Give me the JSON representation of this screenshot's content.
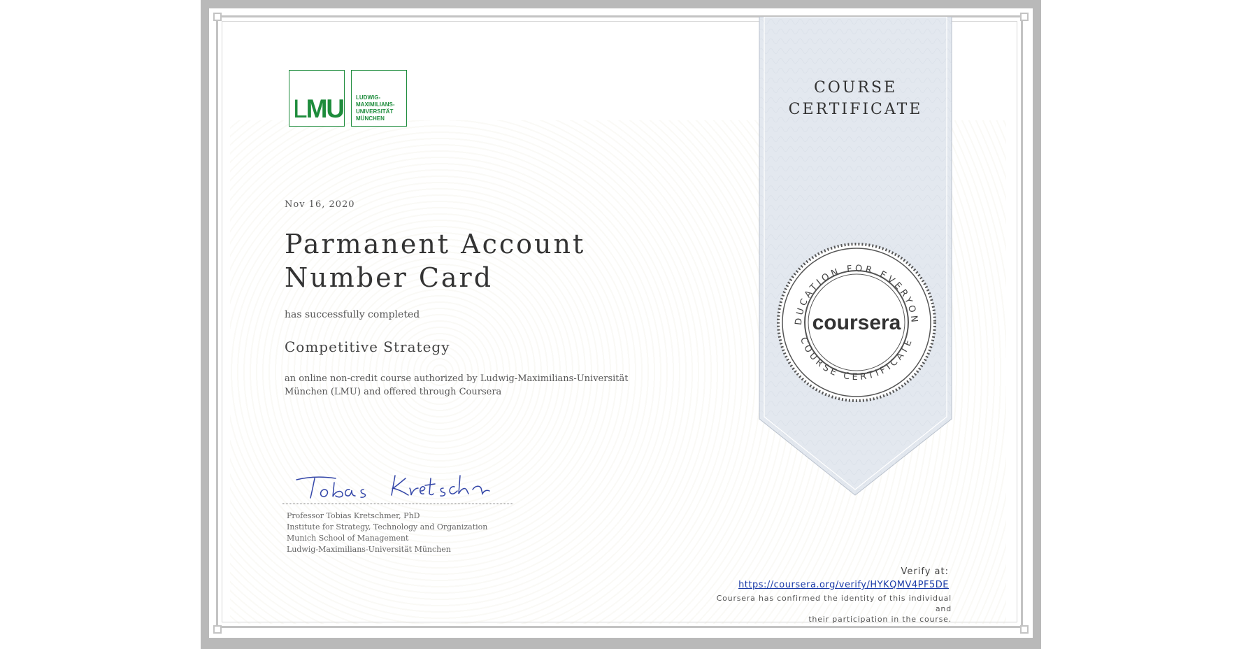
{
  "logo": {
    "abbr_l": "L",
    "abbr_mu": "MU",
    "name_lines": [
      "LUDWIG-",
      "MAXIMILIANS-",
      "UNIVERSITÄT",
      "MÜNCHEN"
    ]
  },
  "certificate": {
    "date": "Nov 16, 2020",
    "recipient_name": "Parmanent Account Number Card",
    "completed_text": "has successfully completed",
    "course_name": "Competitive Strategy",
    "description": "an online non-credit course authorized by Ludwig-Maximilians-Universität München (LMU) and offered through Coursera"
  },
  "signature": {
    "script": "Tobias Kretschmer",
    "lines": [
      "Professor Tobias Kretschmer, PhD",
      "Institute for Strategy, Technology and Organization",
      "Munich School of Management",
      "Ludwig-Maximilians-Universität München"
    ]
  },
  "ribbon": {
    "title_line1": "COURSE",
    "title_line2": "CERTIFICATE",
    "seal_top_text": "EDUCATION FOR EVERYONE",
    "seal_bottom_text": "COURSE CERTIFICATE",
    "seal_brand": "coursera"
  },
  "verify": {
    "label": "Verify at:",
    "url": "https://coursera.org/verify/HYKQMV4PF5DE",
    "note_line1": "Coursera has confirmed the identity of this individual and",
    "note_line2": "their participation in the course."
  },
  "colors": {
    "lmu_green": "#1e8c3c",
    "ribbon": "#e3e8ef",
    "link": "#1a3ba8",
    "frame": "#b9b9b9"
  }
}
